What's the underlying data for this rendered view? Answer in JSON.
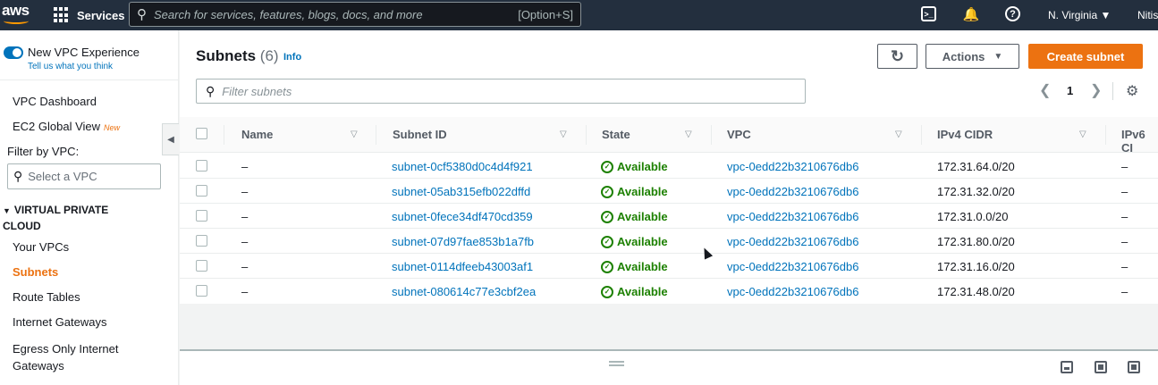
{
  "topnav": {
    "logo": "aws",
    "services_label": "Services",
    "search_placeholder": "Search for services, features, blogs, docs, and more",
    "search_shortcut": "[Option+S]",
    "region": "N. Virginia ▼",
    "user": "Nitis"
  },
  "sidebar": {
    "toggle_label": "New VPC Experience",
    "tell_us": "Tell us what you think",
    "dashboard": "VPC Dashboard",
    "ec2_global": "EC2 Global View",
    "new_badge": "New",
    "filter_label": "Filter by VPC:",
    "vpc_select_placeholder": "Select a VPC",
    "section": "VIRTUAL PRIVATE CLOUD",
    "items": [
      "Your VPCs",
      "Subnets",
      "Route Tables",
      "Internet Gateways",
      "Egress Only Internet Gateways"
    ],
    "active_item": "Subnets"
  },
  "main": {
    "title": "Subnets",
    "count": "(6)",
    "info": "Info",
    "actions_label": "Actions",
    "create_label": "Create subnet",
    "filter_placeholder": "Filter subnets",
    "page": "1",
    "columns": [
      "Name",
      "Subnet ID",
      "State",
      "VPC",
      "IPv4 CIDR",
      "IPv6 CI"
    ],
    "rows": [
      {
        "name": "–",
        "subnet_id": "subnet-0cf5380d0c4d4f921",
        "state": "Available",
        "vpc": "vpc-0edd22b3210676db6",
        "ipv4": "172.31.64.0/20",
        "ipv6": "–"
      },
      {
        "name": "–",
        "subnet_id": "subnet-05ab315efb022dffd",
        "state": "Available",
        "vpc": "vpc-0edd22b3210676db6",
        "ipv4": "172.31.32.0/20",
        "ipv6": "–"
      },
      {
        "name": "–",
        "subnet_id": "subnet-0fece34df470cd359",
        "state": "Available",
        "vpc": "vpc-0edd22b3210676db6",
        "ipv4": "172.31.0.0/20",
        "ipv6": "–"
      },
      {
        "name": "–",
        "subnet_id": "subnet-07d97fae853b1a7fb",
        "state": "Available",
        "vpc": "vpc-0edd22b3210676db6",
        "ipv4": "172.31.80.0/20",
        "ipv6": "–"
      },
      {
        "name": "–",
        "subnet_id": "subnet-0114dfeeb43003af1",
        "state": "Available",
        "vpc": "vpc-0edd22b3210676db6",
        "ipv4": "172.31.16.0/20",
        "ipv6": "–"
      },
      {
        "name": "–",
        "subnet_id": "subnet-080614c77e3cbf2ea",
        "state": "Available",
        "vpc": "vpc-0edd22b3210676db6",
        "ipv4": "172.31.48.0/20",
        "ipv6": "–"
      }
    ]
  },
  "colors": {
    "nav_bg": "#232f3e",
    "accent": "#ec7211",
    "link": "#0073bb",
    "success": "#1d8102"
  }
}
